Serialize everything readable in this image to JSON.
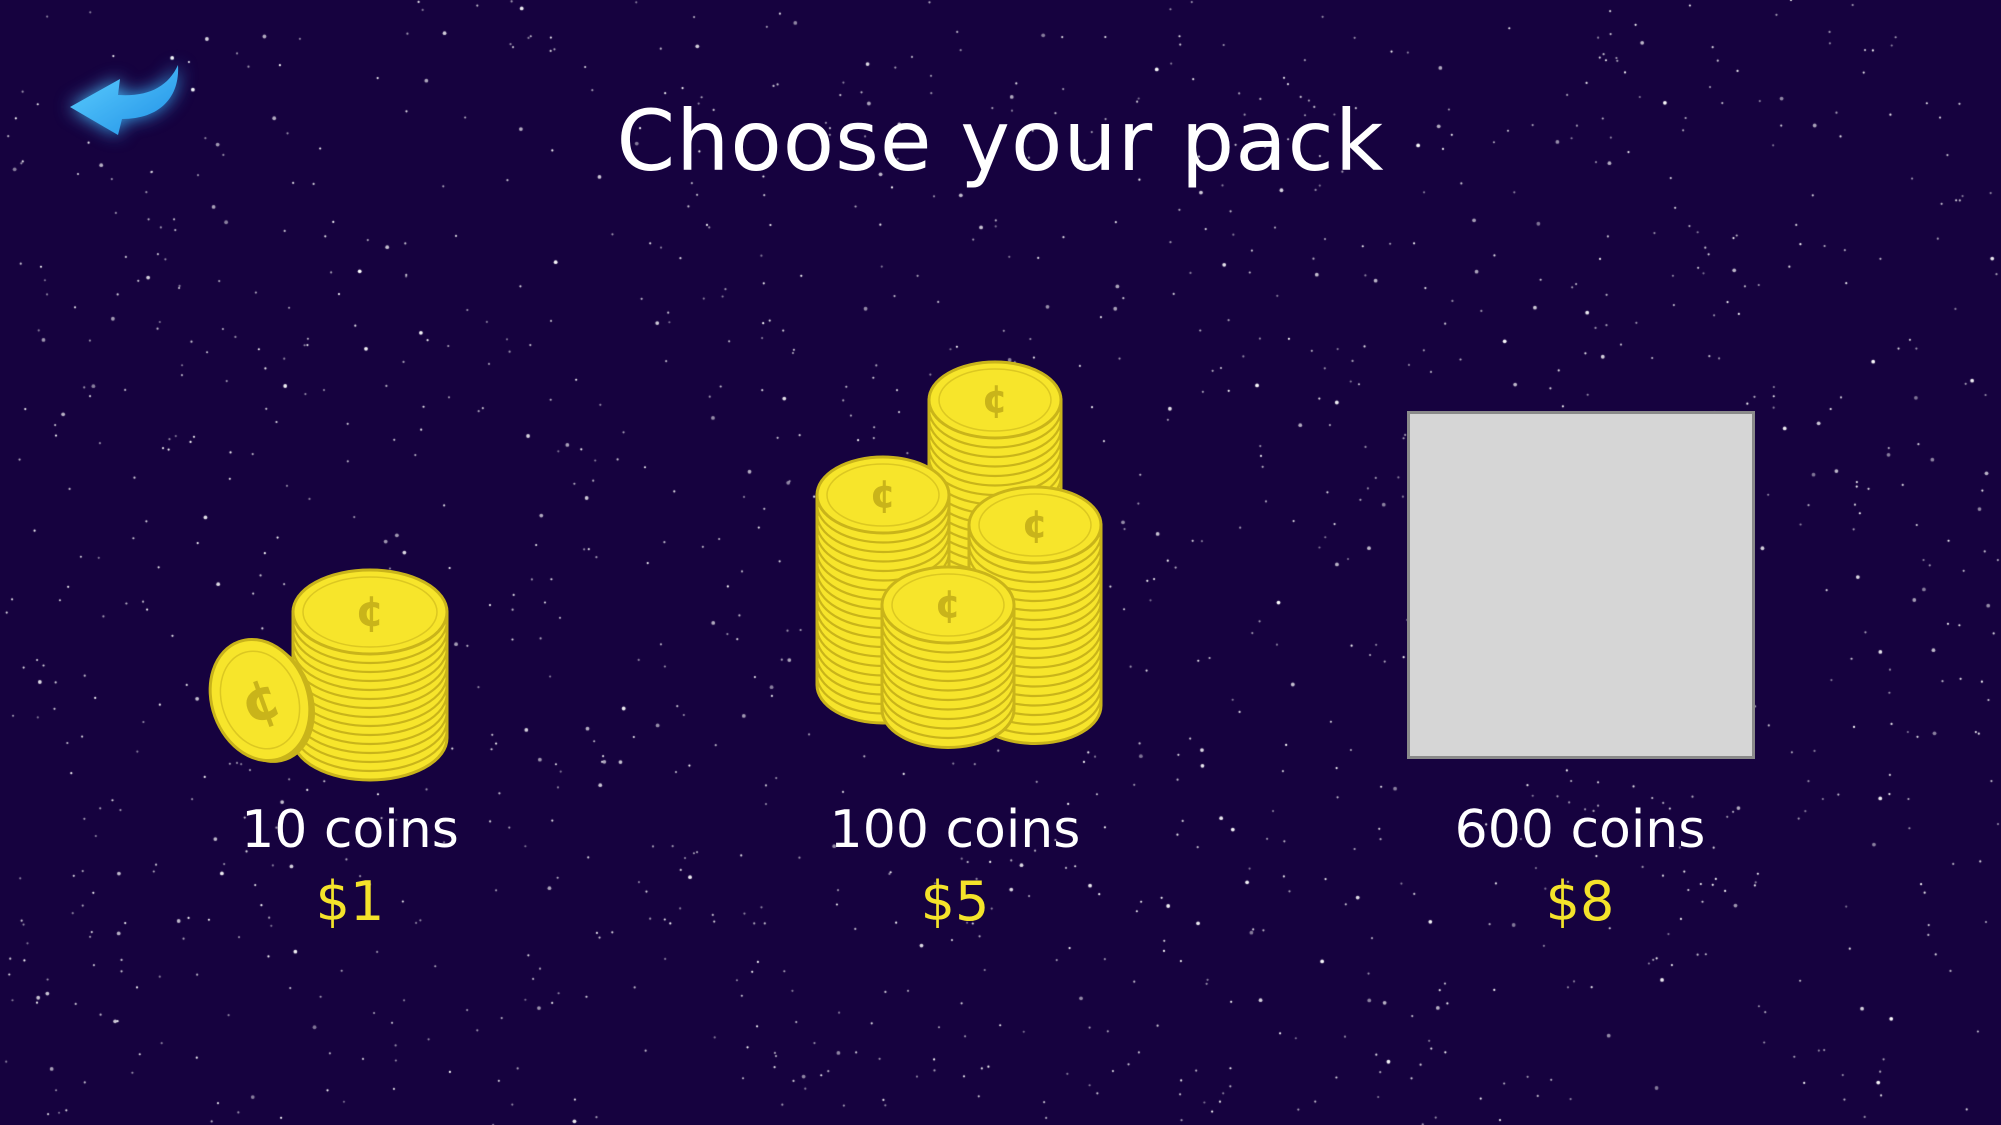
{
  "header": {
    "title": "Choose your pack",
    "back_icon": "back-arrow-icon"
  },
  "packs": [
    {
      "coins_label": "10 coins",
      "price_label": "$1",
      "image": "small-coin-stack-icon"
    },
    {
      "coins_label": "100 coins",
      "price_label": "$5",
      "image": "coin-piles-icon"
    },
    {
      "coins_label": "600 coins",
      "price_label": "$8",
      "image": "image-placeholder"
    }
  ],
  "colors": {
    "background": "#16023f",
    "price": "#f4e32a",
    "coin_face": "#f7e52b",
    "coin_edge": "#c9b41a",
    "back_arrow": "#3bb6f5"
  }
}
